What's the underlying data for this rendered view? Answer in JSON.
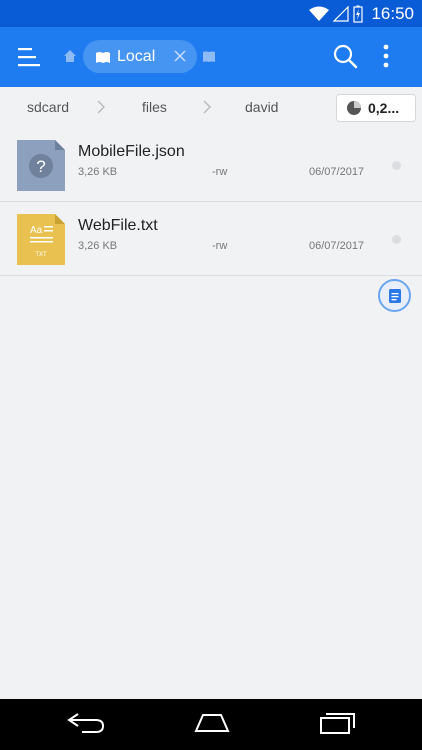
{
  "status_bar": {
    "time": "16:50"
  },
  "app_bar": {
    "tab_label": "Local",
    "icons": [
      "menu-icon",
      "home-icon",
      "book-icon",
      "close-icon",
      "bookmark-icon",
      "search-icon",
      "more-vert-icon"
    ]
  },
  "path": {
    "crumbs": [
      "sdcard",
      "files",
      "david"
    ],
    "storage_label": "0,2..."
  },
  "files": [
    {
      "name": "MobileFile.json",
      "size": "3,26 KB",
      "permissions": "-rw",
      "date": "06/07/2017",
      "icon": "unknown-file-icon",
      "thumb_color": "#8da0bd"
    },
    {
      "name": "WebFile.txt",
      "size": "3,26 KB",
      "permissions": "-rw",
      "date": "06/07/2017",
      "icon": "text-file-icon",
      "thumb_color": "#e8c150"
    }
  ],
  "colors": {
    "status_bar": "#0a5bd6",
    "app_bar": "#1e7cf0",
    "chip": "#4795f2",
    "background": "#f1f2f4"
  }
}
